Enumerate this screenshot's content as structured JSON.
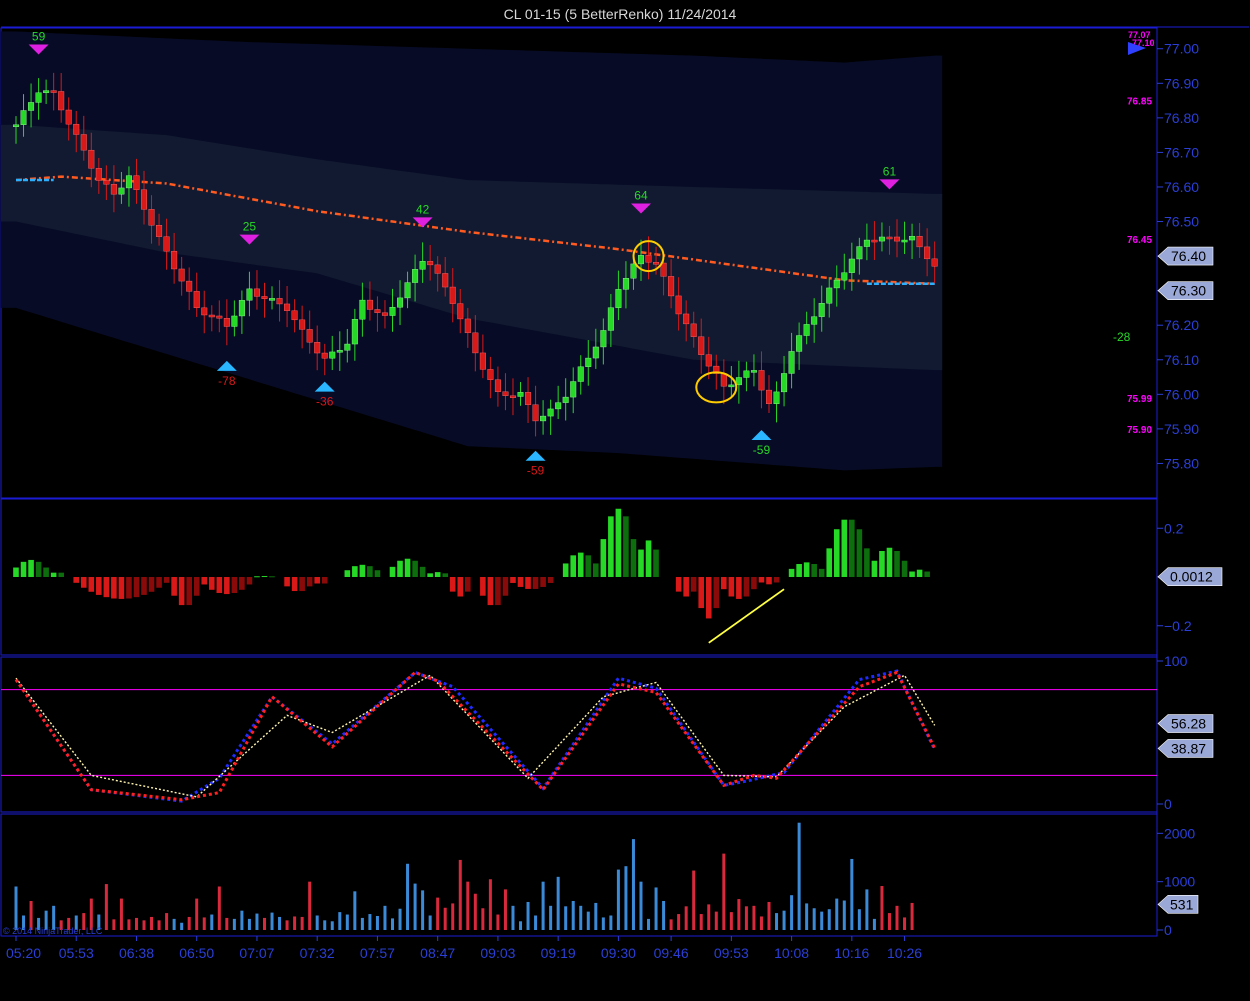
{
  "title": "CL 01-15 (5 BetterRenko)  11/24/2014",
  "watermark": "© 2014 NinjaTrader, LLC",
  "colors": {
    "background": "#000000",
    "frame": "#1b1bd6",
    "axis_text": "#2a3fd6",
    "up": "#27d927",
    "down": "#d91818",
    "up_dark": "#0c6e0c",
    "down_dark": "#8a0a0a",
    "band_outer": "#070b26",
    "band_inner": "#111a30",
    "sma": "#ff5a1f",
    "sma_flat": "#2bb0ff",
    "magenta": "#ff00ff",
    "stoch_k": "#1f2bff",
    "stoch_d": "#ff2020",
    "stoch_slow": "#fff4b0",
    "volume_up": "#3a8ad8",
    "volume_down": "#d82a3c",
    "marker_up": "#2ab7ff",
    "marker_down": "#e020e0",
    "ellipse": "#ffcc00",
    "trendline": "#ffff44",
    "label_box": "#9aa8d8"
  },
  "chart_data": [
    {
      "type": "candlestick",
      "panel": "price",
      "y_ticks": [
        "77.00",
        "76.90",
        "76.80",
        "76.70",
        "76.60",
        "76.50",
        "76.40",
        "76.30",
        "76.20",
        "76.10",
        "76.00",
        "75.90",
        "75.80"
      ],
      "ylim": [
        75.7,
        77.06
      ],
      "price_labels": [
        {
          "text": "76.40",
          "value": 76.4
        },
        {
          "text": "76.30",
          "value": 76.3
        }
      ],
      "side_levels": [
        {
          "text": "76.85",
          "value": 76.85
        },
        {
          "text": "76.45",
          "value": 76.45
        },
        {
          "text": "75.99",
          "value": 75.99
        },
        {
          "text": "75.90",
          "value": 75.9
        }
      ],
      "side_marker_text": "77.07",
      "side_marker_text_2": "77.10",
      "side_value": "-28",
      "peak_markers": [
        {
          "label": "59",
          "index": 3,
          "value": 76.96
        },
        {
          "label": "25",
          "index": 31,
          "value": 76.41
        },
        {
          "label": "42",
          "index": 54,
          "value": 76.46
        },
        {
          "label": "64",
          "index": 83,
          "value": 76.5
        },
        {
          "label": "61",
          "index": 116,
          "value": 76.57
        }
      ],
      "trough_markers": [
        {
          "label": "-78",
          "index": 28,
          "value": 76.12
        },
        {
          "label": "-36",
          "index": 41,
          "value": 76.06
        },
        {
          "label": "-59",
          "index": 69,
          "value": 75.86
        },
        {
          "label": "-59",
          "index": 99,
          "value": 75.92
        }
      ],
      "candle_path": [
        [
          0,
          76.78
        ],
        [
          3,
          76.88
        ],
        [
          5,
          76.87
        ],
        [
          11,
          76.62
        ],
        [
          13,
          76.58
        ],
        [
          15,
          76.63
        ],
        [
          19,
          76.45
        ],
        [
          21,
          76.37
        ],
        [
          24,
          76.25
        ],
        [
          28,
          76.2
        ],
        [
          31,
          76.3
        ],
        [
          36,
          76.25
        ],
        [
          38,
          76.18
        ],
        [
          41,
          76.1
        ],
        [
          44,
          76.15
        ],
        [
          46,
          76.27
        ],
        [
          49,
          76.22
        ],
        [
          52,
          76.32
        ],
        [
          54,
          76.39
        ],
        [
          55,
          76.38
        ],
        [
          58,
          76.27
        ],
        [
          61,
          76.12
        ],
        [
          64,
          76.0
        ],
        [
          67,
          76.0
        ],
        [
          69,
          75.93
        ],
        [
          71,
          75.95
        ],
        [
          73,
          76.0
        ],
        [
          78,
          76.18
        ],
        [
          80,
          76.31
        ],
        [
          83,
          76.4
        ],
        [
          85,
          76.38
        ],
        [
          88,
          76.24
        ],
        [
          91,
          76.12
        ],
        [
          94,
          76.02
        ],
        [
          96,
          76.05
        ],
        [
          98,
          76.07
        ],
        [
          100,
          75.97
        ],
        [
          101,
          76.0
        ],
        [
          103,
          76.13
        ],
        [
          108,
          76.3
        ],
        [
          113,
          76.45
        ],
        [
          115,
          76.45
        ],
        [
          119,
          76.45
        ],
        [
          121,
          76.4
        ],
        [
          122,
          76.37
        ]
      ],
      "sma_line": [
        [
          0,
          76.62
        ],
        [
          6,
          76.63
        ],
        [
          20,
          76.61
        ],
        [
          40,
          76.53
        ],
        [
          60,
          76.47
        ],
        [
          80,
          76.42
        ],
        [
          110,
          76.33
        ],
        [
          122,
          76.32
        ]
      ],
      "sma_flat_segments": [
        [
          [
            0,
            5
          ],
          76.62
        ],
        [
          [
            113,
            122
          ],
          76.32
        ]
      ],
      "band_outer_upper": [
        [
          0,
          77.05
        ],
        [
          30,
          77.02
        ],
        [
          60,
          77.0
        ],
        [
          90,
          76.98
        ],
        [
          110,
          76.96
        ],
        [
          122,
          76.98
        ]
      ],
      "band_outer_lower": [
        [
          0,
          76.25
        ],
        [
          30,
          76.05
        ],
        [
          60,
          75.85
        ],
        [
          80,
          75.83
        ],
        [
          110,
          75.78
        ],
        [
          122,
          75.79
        ]
      ],
      "band_inner_upper": [
        [
          0,
          76.78
        ],
        [
          20,
          76.75
        ],
        [
          40,
          76.68
        ],
        [
          60,
          76.62
        ],
        [
          90,
          76.6
        ],
        [
          122,
          76.58
        ]
      ],
      "band_inner_lower": [
        [
          0,
          76.5
        ],
        [
          20,
          76.41
        ],
        [
          40,
          76.35
        ],
        [
          60,
          76.22
        ],
        [
          90,
          76.1
        ],
        [
          122,
          76.07
        ]
      ],
      "highlights": [
        {
          "index": 84,
          "value": 76.4
        },
        {
          "index": 93,
          "value": 76.02
        }
      ]
    },
    {
      "type": "bar",
      "panel": "oscillator",
      "y_ticks": [
        "0.2",
        "0",
        "-0.2"
      ],
      "ylim": [
        -0.32,
        0.32
      ],
      "current_value_label": "0.0012",
      "current_value": 0.0012,
      "segments": [
        [
          0,
          4,
          0.07
        ],
        [
          5,
          6,
          0.02
        ],
        [
          8,
          20,
          -0.09
        ],
        [
          21,
          24,
          -0.12
        ],
        [
          25,
          31,
          -0.07
        ],
        [
          32,
          34,
          0.004
        ],
        [
          36,
          39,
          -0.06
        ],
        [
          40,
          41,
          -0.03
        ],
        [
          44,
          48,
          0.05
        ],
        [
          50,
          54,
          0.075
        ],
        [
          55,
          57,
          0.02
        ],
        [
          58,
          60,
          -0.08
        ],
        [
          62,
          65,
          -0.12
        ],
        [
          66,
          71,
          -0.05
        ],
        [
          73,
          77,
          0.1
        ],
        [
          78,
          82,
          0.28
        ],
        [
          83,
          85,
          0.15
        ],
        [
          88,
          90,
          -0.08
        ],
        [
          91,
          93,
          -0.17
        ],
        [
          94,
          98,
          -0.09
        ],
        [
          99,
          101,
          -0.03
        ],
        [
          103,
          107,
          0.06
        ],
        [
          108,
          113,
          0.24
        ],
        [
          114,
          118,
          0.12
        ],
        [
          119,
          121,
          0.03
        ]
      ],
      "trendline": [
        [
          92,
          -0.27
        ],
        [
          102,
          -0.05
        ]
      ]
    },
    {
      "type": "line",
      "panel": "stochastics",
      "y_ticks": [
        "100",
        "0"
      ],
      "ylim": [
        0,
        100
      ],
      "levels": [
        80,
        20
      ],
      "value_labels": [
        {
          "text": "56.28",
          "value": 56.28
        },
        {
          "text": "38.87",
          "value": 38.87
        }
      ],
      "series": [
        {
          "points": [
            [
              0,
              87
            ],
            [
              10,
              10
            ],
            [
              22,
              2
            ],
            [
              27,
              18
            ],
            [
              34,
              75
            ],
            [
              42,
              42
            ],
            [
              53,
              92
            ],
            [
              58,
              82
            ],
            [
              70,
              11
            ],
            [
              80,
              88
            ],
            [
              85,
              81
            ],
            [
              94,
              13
            ],
            [
              97,
              16
            ],
            [
              102,
              22
            ],
            [
              112,
              87
            ],
            [
              117,
              93
            ],
            [
              122,
              38
            ]
          ]
        },
        {
          "points": [
            [
              0,
              88
            ],
            [
              10,
              20
            ],
            [
              24,
              5
            ],
            [
              36,
              62
            ],
            [
              42,
              50
            ],
            [
              55,
              90
            ],
            [
              68,
              18
            ],
            [
              78,
              75
            ],
            [
              85,
              85
            ],
            [
              94,
              20
            ],
            [
              101,
              19
            ],
            [
              110,
              68
            ],
            [
              118,
              90
            ],
            [
              122,
              55
            ]
          ]
        },
        {
          "points": [
            [
              0,
              87
            ],
            [
              10,
              10
            ],
            [
              22,
              3
            ],
            [
              27,
              8
            ],
            [
              34,
              75
            ],
            [
              42,
              40
            ],
            [
              53,
              92
            ],
            [
              56,
              86
            ],
            [
              70,
              10
            ],
            [
              80,
              84
            ],
            [
              85,
              78
            ],
            [
              94,
              13
            ],
            [
              98,
              20
            ],
            [
              101,
              18
            ],
            [
              112,
              82
            ],
            [
              117,
              92
            ],
            [
              122,
              39
            ]
          ]
        }
      ]
    },
    {
      "type": "bar",
      "panel": "volume",
      "y_ticks": [
        "2000",
        "1000",
        "0"
      ],
      "ylim": [
        0,
        2400
      ],
      "current_value_label": "531",
      "current_value": 531,
      "values": [
        900,
        300,
        600,
        250,
        400,
        500,
        200,
        250,
        300,
        350,
        650,
        320,
        950,
        220,
        650,
        220,
        250,
        200,
        270,
        200,
        350,
        230,
        150,
        270,
        650,
        260,
        320,
        900,
        250,
        230,
        400,
        230,
        340,
        250,
        360,
        270,
        200,
        280,
        270,
        1000,
        300,
        200,
        180,
        370,
        320,
        800,
        250,
        330,
        290,
        500,
        240,
        440,
        1370,
        960,
        820,
        300,
        670,
        460,
        550,
        1450,
        1000,
        750,
        450,
        1050,
        320,
        840,
        500,
        180,
        580,
        300,
        1000,
        500,
        1100,
        490,
        600,
        500,
        380,
        560,
        260,
        300,
        1250,
        1320,
        1880,
        1000,
        230,
        880,
        600,
        220,
        330,
        490,
        1230,
        330,
        530,
        380,
        1580,
        370,
        640,
        490,
        500,
        280,
        580,
        350,
        400,
        720,
        2220,
        550,
        450,
        380,
        430,
        650,
        610,
        1470,
        430,
        840,
        230,
        910,
        350,
        500,
        260,
        560
      ],
      "up_flags": [
        1,
        1,
        0,
        1,
        1,
        1,
        0,
        0,
        1,
        0,
        0,
        1,
        0,
        0,
        0,
        0,
        0,
        0,
        0,
        0,
        0,
        1,
        1,
        0,
        0,
        0,
        1,
        0,
        0,
        1,
        1,
        1,
        1,
        0,
        1,
        1,
        0,
        0,
        0,
        0,
        1,
        1,
        1,
        1,
        1,
        1,
        1,
        1,
        1,
        1,
        1,
        1,
        1,
        1,
        1,
        1,
        0,
        0,
        0,
        0,
        0,
        0,
        0,
        0,
        0,
        0,
        1,
        1,
        1,
        1,
        1,
        1,
        1,
        1,
        1,
        1,
        1,
        1,
        1,
        1,
        1,
        1,
        1,
        1,
        1,
        1,
        1,
        0,
        0,
        0,
        0,
        0,
        0,
        0,
        0,
        0,
        0,
        0,
        0,
        0,
        0,
        1,
        1,
        1,
        1,
        1,
        1,
        1,
        1,
        1,
        1,
        1,
        1,
        1,
        1,
        0,
        0,
        0,
        0
      ]
    }
  ],
  "time_labels": [
    {
      "text": "05:20",
      "index": 0
    },
    {
      "text": "05:53",
      "index": 8
    },
    {
      "text": "06:38",
      "index": 16
    },
    {
      "text": "06:50",
      "index": 24
    },
    {
      "text": "07:07",
      "index": 32
    },
    {
      "text": "07:32",
      "index": 40
    },
    {
      "text": "07:57",
      "index": 48
    },
    {
      "text": "08:47",
      "index": 56
    },
    {
      "text": "09:03",
      "index": 64
    },
    {
      "text": "09:19",
      "index": 72
    },
    {
      "text": "09:30",
      "index": 80
    },
    {
      "text": "09:46",
      "index": 87
    },
    {
      "text": "09:53",
      "index": 95
    },
    {
      "text": "10:08",
      "index": 103
    },
    {
      "text": "10:16",
      "index": 111
    },
    {
      "text": "10:26",
      "index": 118
    }
  ]
}
